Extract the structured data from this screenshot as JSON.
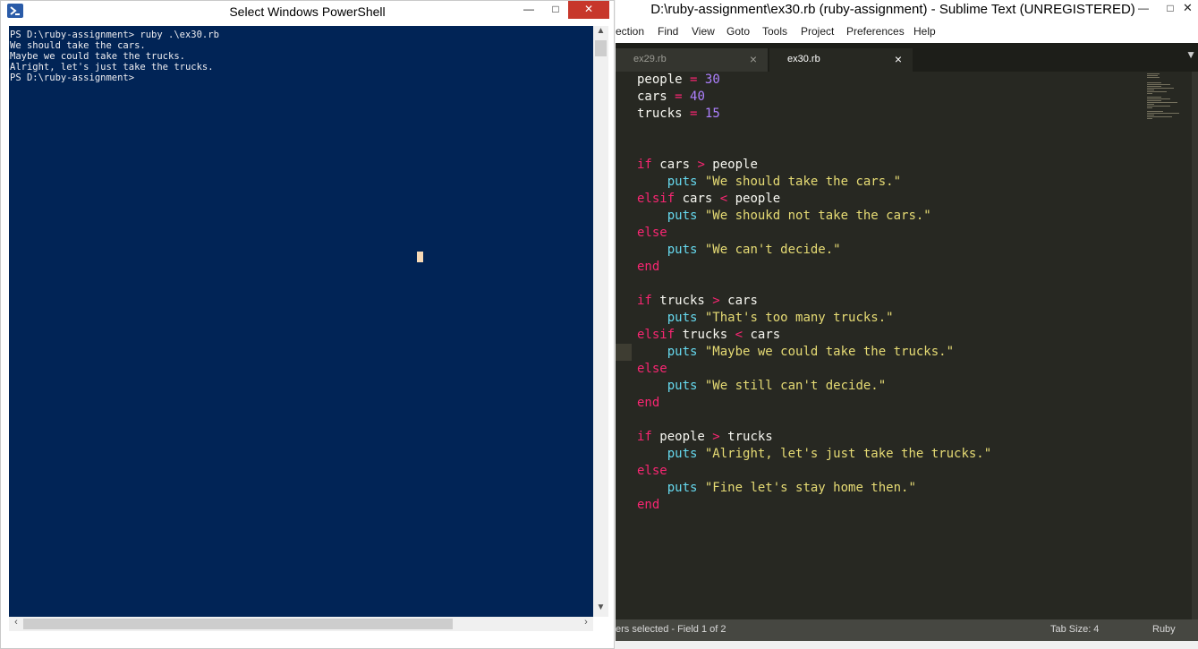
{
  "powershell": {
    "title": "Select Windows PowerShell",
    "console_lines": [
      "PS D:\\ruby-assignment> ruby .\\ex30.rb",
      "We should take the cars.",
      "Maybe we could take the trucks.",
      "Alright, let's just take the trucks.",
      "PS D:\\ruby-assignment>"
    ],
    "colors": {
      "background": "#012456",
      "text": "#eeedf0",
      "cursor": "#f7d9b5"
    }
  },
  "sublime": {
    "title": "D:\\ruby-assignment\\ex30.rb (ruby-assignment) - Sublime Text (UNREGISTERED)",
    "menu": [
      "ection",
      "Find",
      "View",
      "Goto",
      "Tools",
      "Project",
      "Preferences",
      "Help"
    ],
    "tabs": [
      {
        "label": "ex29.rb",
        "active": false
      },
      {
        "label": "ex30.rb",
        "active": true
      }
    ],
    "code_lines": [
      [
        {
          "t": "people ",
          "c": ""
        },
        {
          "t": "=",
          "c": "op"
        },
        {
          "t": " ",
          "c": ""
        },
        {
          "t": "30",
          "c": "num"
        }
      ],
      [
        {
          "t": "cars ",
          "c": ""
        },
        {
          "t": "=",
          "c": "op"
        },
        {
          "t": " ",
          "c": ""
        },
        {
          "t": "40",
          "c": "num"
        }
      ],
      [
        {
          "t": "trucks ",
          "c": ""
        },
        {
          "t": "=",
          "c": "op"
        },
        {
          "t": " ",
          "c": ""
        },
        {
          "t": "15",
          "c": "num"
        }
      ],
      [],
      [],
      [
        {
          "t": "if",
          "c": "kw"
        },
        {
          "t": " cars ",
          "c": ""
        },
        {
          "t": ">",
          "c": "op"
        },
        {
          "t": " people",
          "c": ""
        }
      ],
      [
        {
          "t": "    ",
          "c": ""
        },
        {
          "t": "puts",
          "c": "fn"
        },
        {
          "t": " ",
          "c": ""
        },
        {
          "t": "\"We should take the cars.\"",
          "c": "str"
        }
      ],
      [
        {
          "t": "elsif",
          "c": "kw"
        },
        {
          "t": " cars ",
          "c": ""
        },
        {
          "t": "<",
          "c": "op"
        },
        {
          "t": " people",
          "c": ""
        }
      ],
      [
        {
          "t": "    ",
          "c": ""
        },
        {
          "t": "puts",
          "c": "fn"
        },
        {
          "t": " ",
          "c": ""
        },
        {
          "t": "\"We shoukd not take the cars.\"",
          "c": "str"
        }
      ],
      [
        {
          "t": "else",
          "c": "kw"
        }
      ],
      [
        {
          "t": "    ",
          "c": ""
        },
        {
          "t": "puts",
          "c": "fn"
        },
        {
          "t": " ",
          "c": ""
        },
        {
          "t": "\"We can't decide.\"",
          "c": "str"
        }
      ],
      [
        {
          "t": "end",
          "c": "kw"
        }
      ],
      [],
      [
        {
          "t": "if",
          "c": "kw"
        },
        {
          "t": " trucks ",
          "c": ""
        },
        {
          "t": ">",
          "c": "op"
        },
        {
          "t": " cars",
          "c": ""
        }
      ],
      [
        {
          "t": "    ",
          "c": ""
        },
        {
          "t": "puts",
          "c": "fn"
        },
        {
          "t": " ",
          "c": ""
        },
        {
          "t": "\"That's too many trucks.\"",
          "c": "str"
        }
      ],
      [
        {
          "t": "elsif",
          "c": "kw"
        },
        {
          "t": " trucks ",
          "c": ""
        },
        {
          "t": "<",
          "c": "op"
        },
        {
          "t": " cars",
          "c": ""
        }
      ],
      [
        {
          "t": "    ",
          "c": ""
        },
        {
          "t": "puts",
          "c": "fn"
        },
        {
          "t": " ",
          "c": ""
        },
        {
          "t": "\"Maybe we could take the trucks.\"",
          "c": "str"
        }
      ],
      [
        {
          "t": "else",
          "c": "kw"
        }
      ],
      [
        {
          "t": "    ",
          "c": ""
        },
        {
          "t": "puts",
          "c": "fn"
        },
        {
          "t": " ",
          "c": ""
        },
        {
          "t": "\"We still can't decide.\"",
          "c": "str"
        }
      ],
      [
        {
          "t": "end",
          "c": "kw"
        }
      ],
      [],
      [
        {
          "t": "if",
          "c": "kw"
        },
        {
          "t": " people ",
          "c": ""
        },
        {
          "t": ">",
          "c": "op"
        },
        {
          "t": " trucks",
          "c": ""
        }
      ],
      [
        {
          "t": "    ",
          "c": ""
        },
        {
          "t": "puts",
          "c": "fn"
        },
        {
          "t": " ",
          "c": ""
        },
        {
          "t": "\"Alright, let's just take the trucks.\"",
          "c": "str"
        }
      ],
      [
        {
          "t": "else",
          "c": "kw"
        }
      ],
      [
        {
          "t": "    ",
          "c": ""
        },
        {
          "t": "puts",
          "c": "fn"
        },
        {
          "t": " ",
          "c": ""
        },
        {
          "t": "\"Fine let's stay home then.\"",
          "c": "str"
        }
      ],
      [
        {
          "t": "end",
          "c": "kw"
        }
      ]
    ],
    "status": {
      "left": "ers selected - Field 1 of 2",
      "tab_size": "Tab Size: 4",
      "syntax": "Ruby"
    },
    "colors": {
      "editor_bg": "#272822",
      "keyword": "#f92672",
      "number": "#ae81ff",
      "function": "#66d9ef",
      "string": "#e6db74",
      "text": "#f8f8f2"
    }
  }
}
